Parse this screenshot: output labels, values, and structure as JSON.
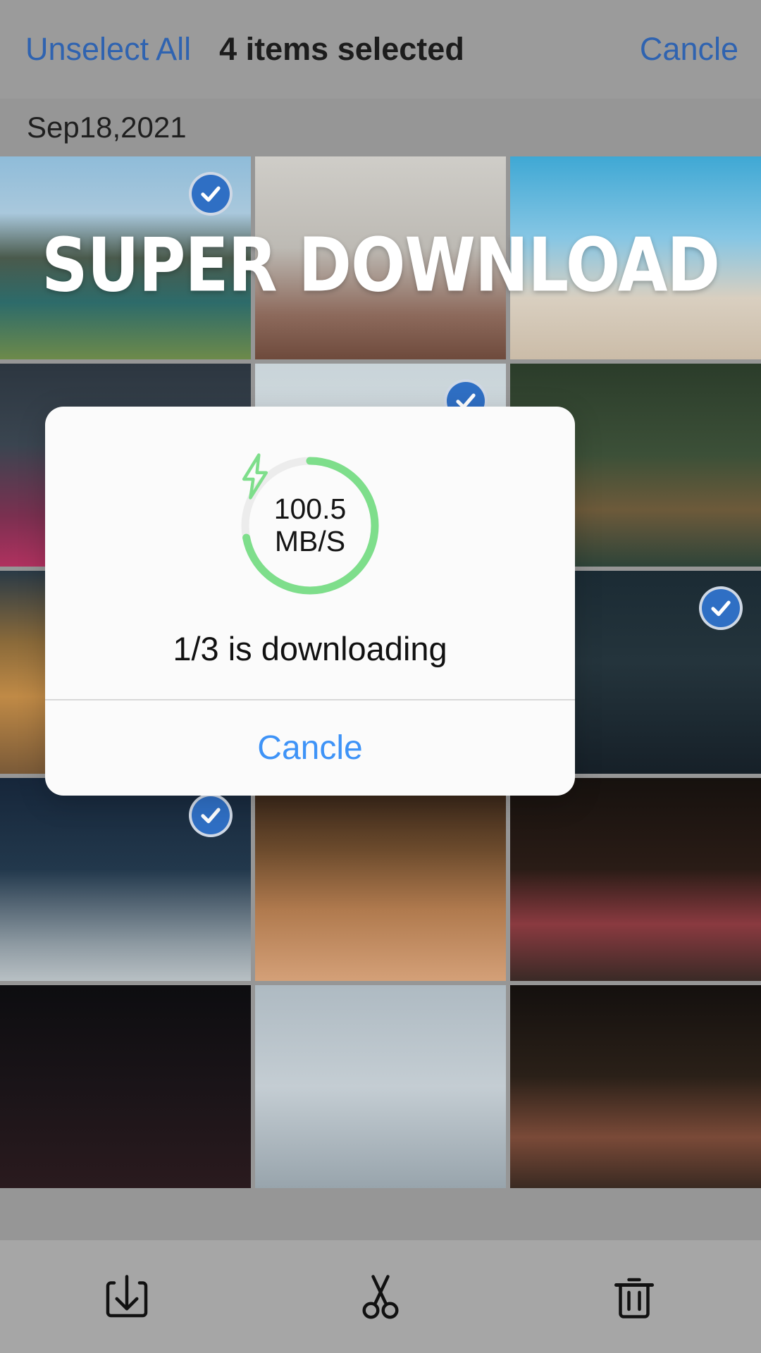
{
  "topbar": {
    "unselect_label": "Unselect All",
    "count_label": "4 items selected",
    "cancel_label": "Cancle",
    "link_color": "#2f63b0",
    "background": "#9b9b9b"
  },
  "date_band": {
    "label": "Sep18,2021"
  },
  "watermark": {
    "text": "SUPER DOWNLOAD",
    "color": "#ffffff"
  },
  "gallery": {
    "columns": 3,
    "selected_count": 4,
    "items": [
      {
        "name": "mountain-lake-photo",
        "selected": true,
        "alt": "mountain lake"
      },
      {
        "name": "woman-window-photo",
        "selected": false,
        "alt": "woman by window"
      },
      {
        "name": "santorini-coast-photo",
        "selected": false,
        "alt": "santorini coast"
      },
      {
        "name": "woman-pink-dress-photo",
        "selected": false,
        "alt": "woman in pink"
      },
      {
        "name": "pale-sky-photo",
        "selected": true,
        "alt": "pale sky"
      },
      {
        "name": "forest-cabin-photo",
        "selected": false,
        "alt": "forest cabin"
      },
      {
        "name": "cinque-terre-photo",
        "selected": false,
        "alt": "colorful houses"
      },
      {
        "name": "dark-texture-photo",
        "selected": false,
        "alt": "dark texture"
      },
      {
        "name": "dark-hair-photo",
        "selected": true,
        "alt": "dark hair"
      },
      {
        "name": "flag-night-photo",
        "selected": true,
        "alt": "flag at night"
      },
      {
        "name": "curly-hair-woman-photo",
        "selected": false,
        "alt": "curly hair woman"
      },
      {
        "name": "red-beret-woman-photo",
        "selected": false,
        "alt": "woman in red beret"
      },
      {
        "name": "dark-abstract-photo",
        "selected": false,
        "alt": "dark abstract"
      },
      {
        "name": "cloud-sky-photo",
        "selected": false,
        "alt": "cloudy sky"
      },
      {
        "name": "desk-books-photo",
        "selected": false,
        "alt": "desk with books"
      }
    ]
  },
  "dialog": {
    "speed_value": "100.5",
    "speed_unit": "MB/S",
    "status_text": "1/3 is downloading",
    "cancel_label": "Cancle",
    "progress_percent": 72,
    "ring_color": "#7ede8b",
    "ring_track_color": "#ececec",
    "cancel_color": "#3e93f7",
    "bolt_icon": "lightning-bolt-icon"
  },
  "bottombar": {
    "background": "#a6a6a6",
    "actions": [
      {
        "name": "download-button",
        "icon": "download-icon",
        "label": "Download"
      },
      {
        "name": "cut-button",
        "icon": "scissors-icon",
        "label": "Cut"
      },
      {
        "name": "delete-button",
        "icon": "trash-icon",
        "label": "Delete"
      }
    ]
  }
}
